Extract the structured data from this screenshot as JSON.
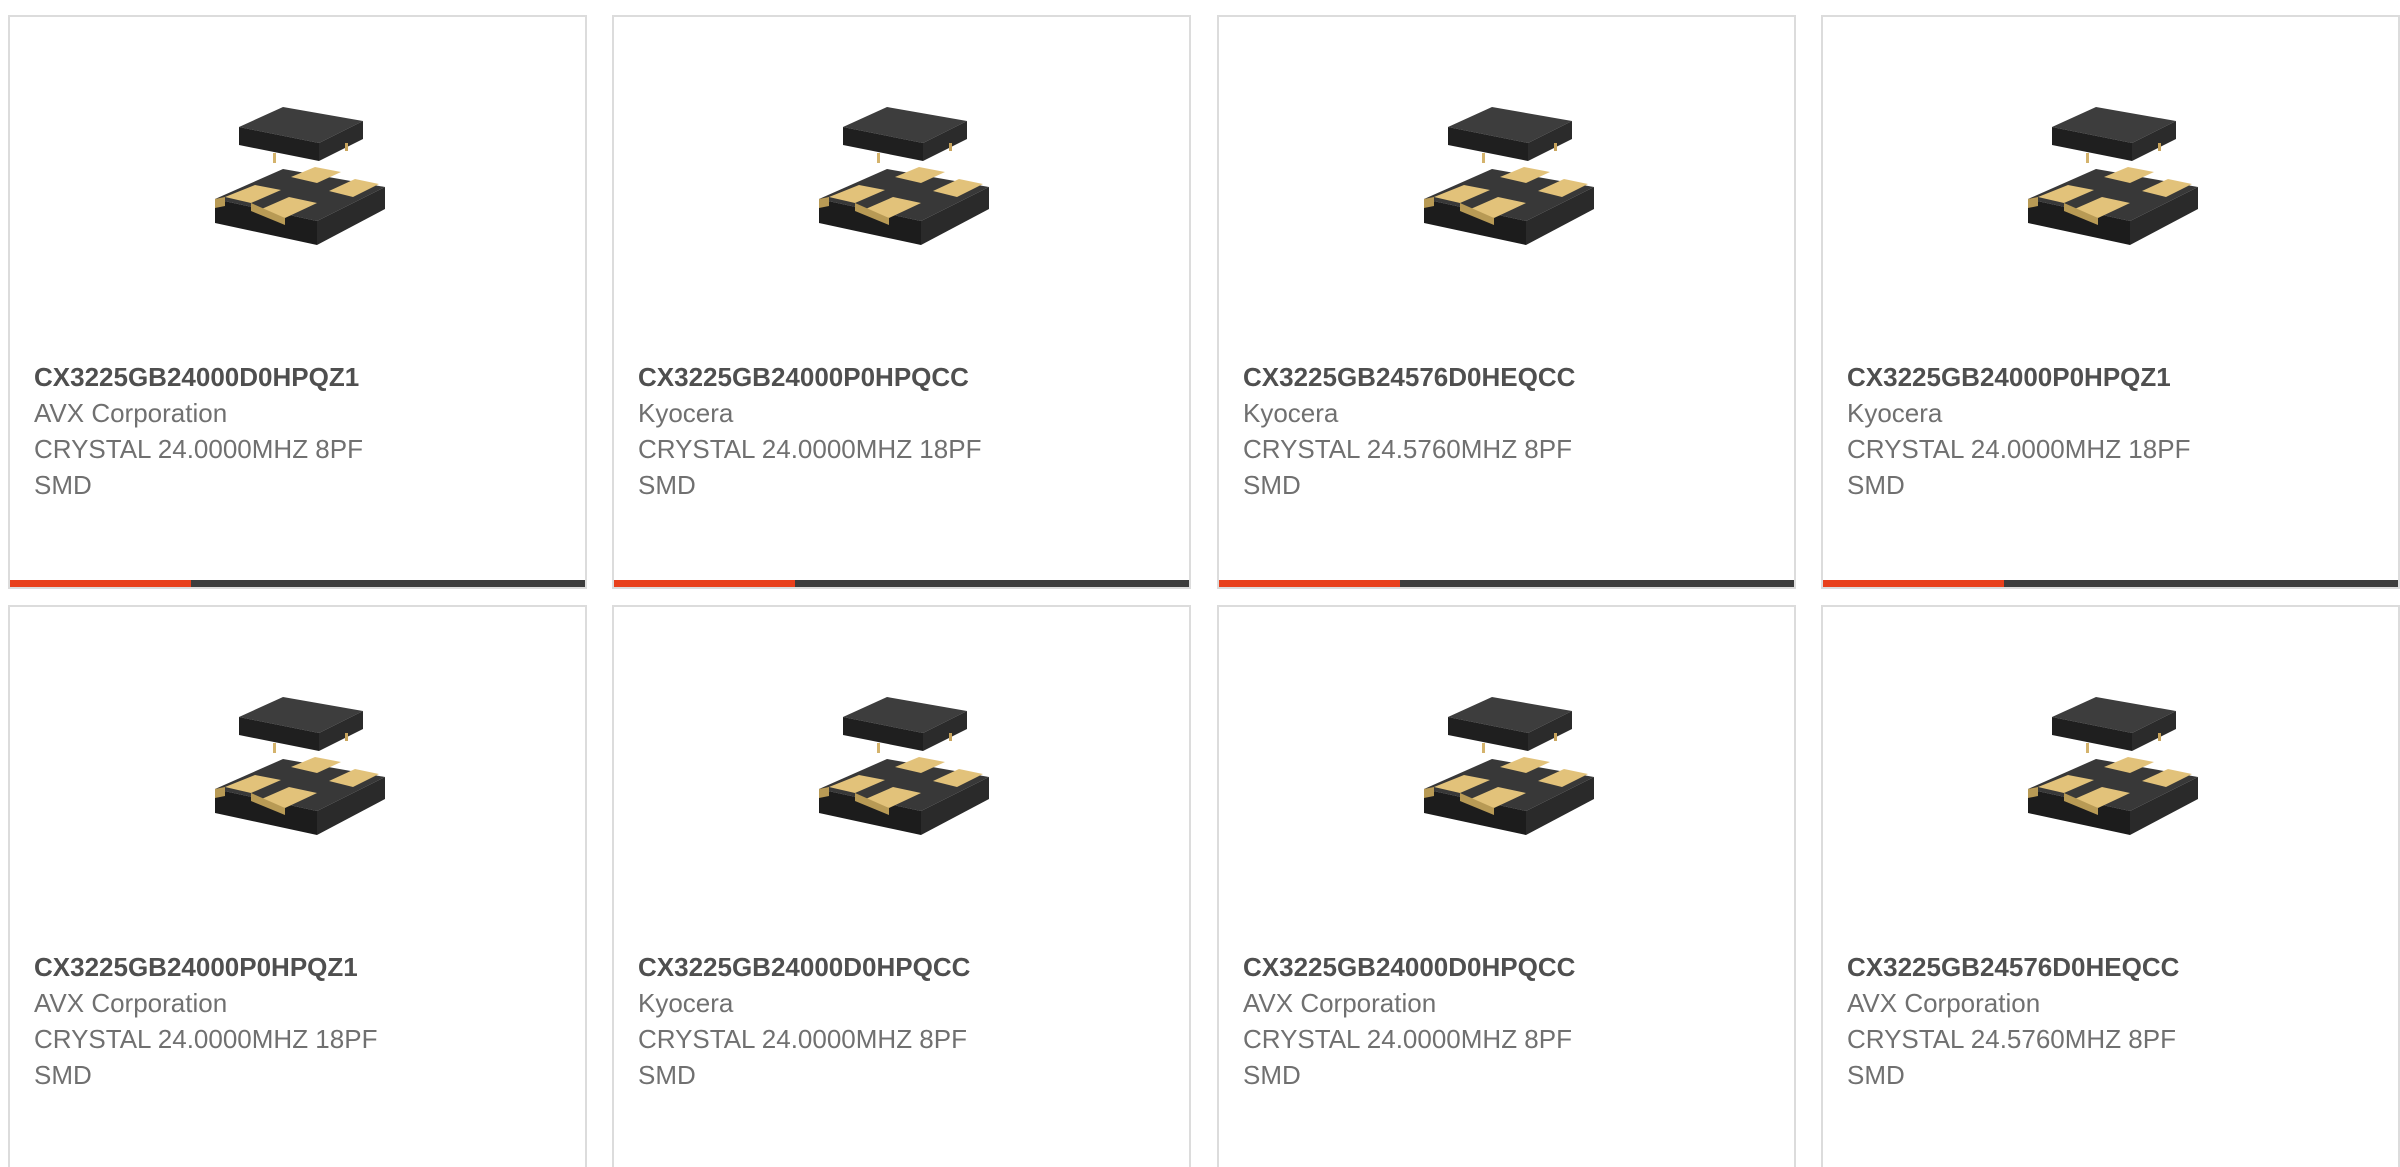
{
  "theme": {
    "accent": "#e8401c",
    "bar_base": "#3c3c3c"
  },
  "products": [
    {
      "part_number": "CX3225GB24000D0HPQZ1",
      "manufacturer": "AVX Corporation",
      "description": "CRYSTAL 24.0000MHZ 8PF",
      "package": "SMD",
      "icon": "crystal-oscillator-icon"
    },
    {
      "part_number": "CX3225GB24000P0HPQCC",
      "manufacturer": "Kyocera",
      "description": "CRYSTAL 24.0000MHZ 18PF",
      "package": "SMD",
      "icon": "crystal-oscillator-icon"
    },
    {
      "part_number": "CX3225GB24576D0HEQCC",
      "manufacturer": "Kyocera",
      "description": "CRYSTAL 24.5760MHZ 8PF",
      "package": "SMD",
      "icon": "crystal-oscillator-icon"
    },
    {
      "part_number": "CX3225GB24000P0HPQZ1",
      "manufacturer": "Kyocera",
      "description": "CRYSTAL 24.0000MHZ 18PF",
      "package": "SMD",
      "icon": "crystal-oscillator-icon"
    },
    {
      "part_number": "CX3225GB24000P0HPQZ1",
      "manufacturer": "AVX Corporation",
      "description": "CRYSTAL 24.0000MHZ 18PF",
      "package": "SMD",
      "icon": "crystal-oscillator-icon"
    },
    {
      "part_number": "CX3225GB24000D0HPQCC",
      "manufacturer": "Kyocera",
      "description": "CRYSTAL 24.0000MHZ 8PF",
      "package": "SMD",
      "icon": "crystal-oscillator-icon"
    },
    {
      "part_number": "CX3225GB24000D0HPQCC",
      "manufacturer": "AVX Corporation",
      "description": "CRYSTAL 24.0000MHZ 8PF",
      "package": "SMD",
      "icon": "crystal-oscillator-icon"
    },
    {
      "part_number": "CX3225GB24576D0HEQCC",
      "manufacturer": "AVX Corporation",
      "description": "CRYSTAL 24.5760MHZ 8PF",
      "package": "SMD",
      "icon": "crystal-oscillator-icon"
    }
  ]
}
